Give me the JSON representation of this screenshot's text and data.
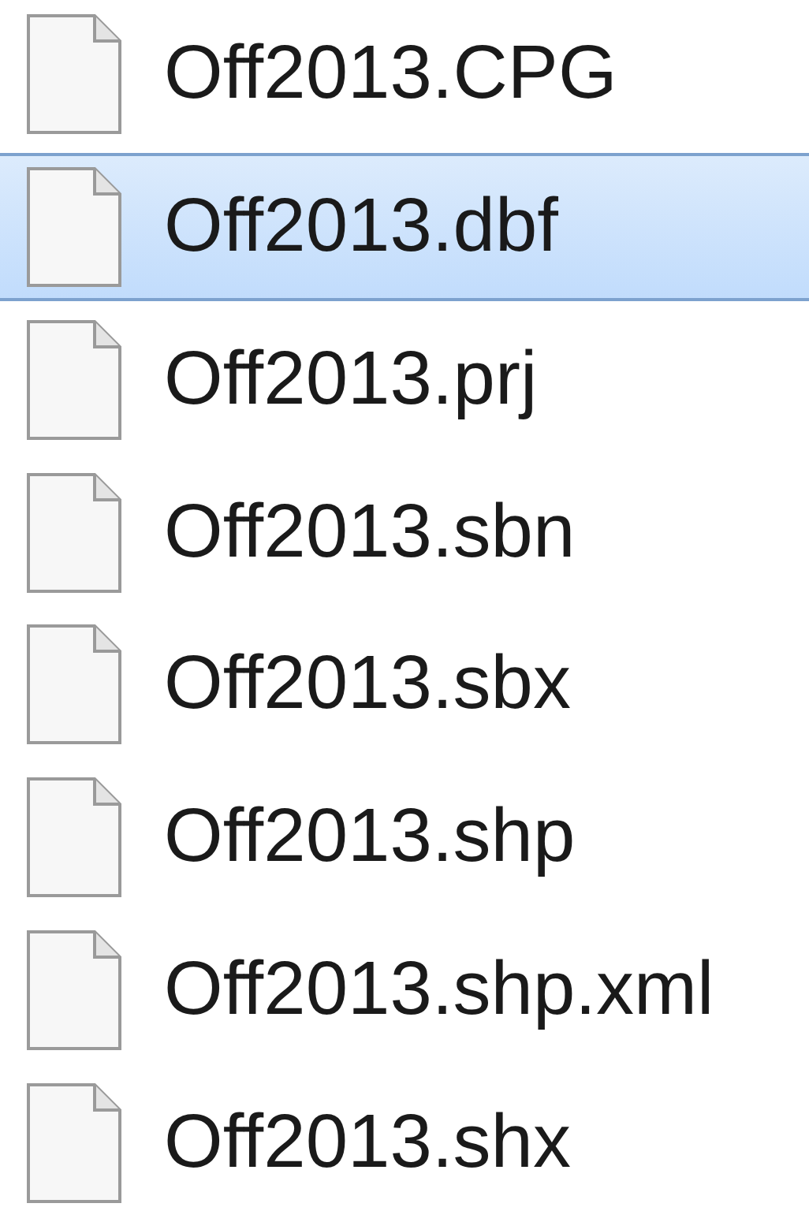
{
  "files": [
    {
      "name": "Off2013.CPG",
      "selected": false
    },
    {
      "name": "Off2013.dbf",
      "selected": true
    },
    {
      "name": "Off2013.prj",
      "selected": false
    },
    {
      "name": "Off2013.sbn",
      "selected": false
    },
    {
      "name": "Off2013.sbx",
      "selected": false
    },
    {
      "name": "Off2013.shp",
      "selected": false
    },
    {
      "name": "Off2013.shp.xml",
      "selected": false
    },
    {
      "name": "Off2013.shx",
      "selected": false
    }
  ]
}
